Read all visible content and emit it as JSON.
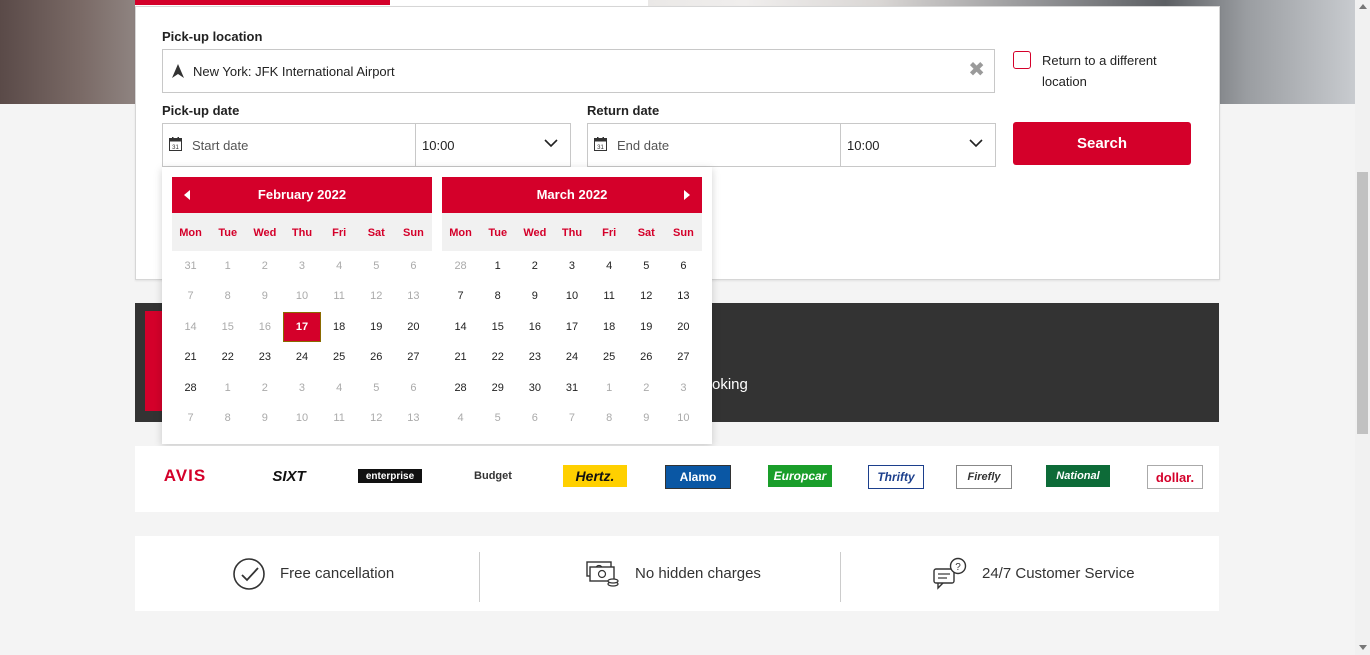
{
  "form": {
    "pickup_location_label": "Pick-up location",
    "pickup_location_value": "New York: JFK International Airport",
    "clear_symbol": "✖",
    "return_different_label": "Return to a different location",
    "pickup_date_label": "Pick-up date",
    "pickup_date_placeholder": "Start date",
    "pickup_time": "10:00",
    "return_date_label": "Return date",
    "return_date_placeholder": "End date",
    "return_time": "10:00",
    "search_label": "Search"
  },
  "promo": {
    "text": "oking"
  },
  "calendar": {
    "weekdays": [
      "Mon",
      "Tue",
      "Wed",
      "Thu",
      "Fri",
      "Sat",
      "Sun"
    ],
    "months": [
      {
        "title": "February 2022",
        "days": [
          {
            "d": "31",
            "m": true
          },
          {
            "d": "1",
            "m": true
          },
          {
            "d": "2",
            "m": true
          },
          {
            "d": "3",
            "m": true
          },
          {
            "d": "4",
            "m": true
          },
          {
            "d": "5",
            "m": true
          },
          {
            "d": "6",
            "m": true
          },
          {
            "d": "7",
            "m": true
          },
          {
            "d": "8",
            "m": true
          },
          {
            "d": "9",
            "m": true
          },
          {
            "d": "10",
            "m": true
          },
          {
            "d": "11",
            "m": true
          },
          {
            "d": "12",
            "m": true
          },
          {
            "d": "13",
            "m": true
          },
          {
            "d": "14",
            "m": true
          },
          {
            "d": "15",
            "m": true
          },
          {
            "d": "16",
            "m": true
          },
          {
            "d": "17",
            "sel": true
          },
          {
            "d": "18"
          },
          {
            "d": "19"
          },
          {
            "d": "20"
          },
          {
            "d": "21"
          },
          {
            "d": "22"
          },
          {
            "d": "23"
          },
          {
            "d": "24"
          },
          {
            "d": "25"
          },
          {
            "d": "26"
          },
          {
            "d": "27"
          },
          {
            "d": "28"
          },
          {
            "d": "1",
            "m": true
          },
          {
            "d": "2",
            "m": true
          },
          {
            "d": "3",
            "m": true
          },
          {
            "d": "4",
            "m": true
          },
          {
            "d": "5",
            "m": true
          },
          {
            "d": "6",
            "m": true
          },
          {
            "d": "7",
            "m": true
          },
          {
            "d": "8",
            "m": true
          },
          {
            "d": "9",
            "m": true
          },
          {
            "d": "10",
            "m": true
          },
          {
            "d": "11",
            "m": true
          },
          {
            "d": "12",
            "m": true
          },
          {
            "d": "13",
            "m": true
          }
        ]
      },
      {
        "title": "March 2022",
        "days": [
          {
            "d": "28",
            "m": true
          },
          {
            "d": "1"
          },
          {
            "d": "2"
          },
          {
            "d": "3"
          },
          {
            "d": "4"
          },
          {
            "d": "5"
          },
          {
            "d": "6"
          },
          {
            "d": "7"
          },
          {
            "d": "8"
          },
          {
            "d": "9"
          },
          {
            "d": "10"
          },
          {
            "d": "11"
          },
          {
            "d": "12"
          },
          {
            "d": "13"
          },
          {
            "d": "14"
          },
          {
            "d": "15"
          },
          {
            "d": "16"
          },
          {
            "d": "17"
          },
          {
            "d": "18"
          },
          {
            "d": "19"
          },
          {
            "d": "20"
          },
          {
            "d": "21"
          },
          {
            "d": "22"
          },
          {
            "d": "23"
          },
          {
            "d": "24"
          },
          {
            "d": "25"
          },
          {
            "d": "26"
          },
          {
            "d": "27"
          },
          {
            "d": "28"
          },
          {
            "d": "29"
          },
          {
            "d": "30"
          },
          {
            "d": "31"
          },
          {
            "d": "1",
            "m": true
          },
          {
            "d": "2",
            "m": true
          },
          {
            "d": "3",
            "m": true
          },
          {
            "d": "4",
            "m": true
          },
          {
            "d": "5",
            "m": true
          },
          {
            "d": "6",
            "m": true
          },
          {
            "d": "7",
            "m": true
          },
          {
            "d": "8",
            "m": true
          },
          {
            "d": "9",
            "m": true
          },
          {
            "d": "10",
            "m": true
          }
        ]
      }
    ]
  },
  "brands": [
    "AVIS",
    "SIXT",
    "enterprise",
    "Budget",
    "Hertz.",
    "Alamo",
    "Europcar",
    "Thrifty",
    "Firefly",
    "National",
    "dollar."
  ],
  "features": [
    {
      "label": "Free cancellation",
      "icon": "checkmark-circle-icon"
    },
    {
      "label": "No hidden charges",
      "icon": "money-icon"
    },
    {
      "label": "24/7 Customer Service",
      "icon": "support-chat-icon"
    }
  ],
  "colors": {
    "accent": "#d4002a",
    "dark": "#333333"
  }
}
